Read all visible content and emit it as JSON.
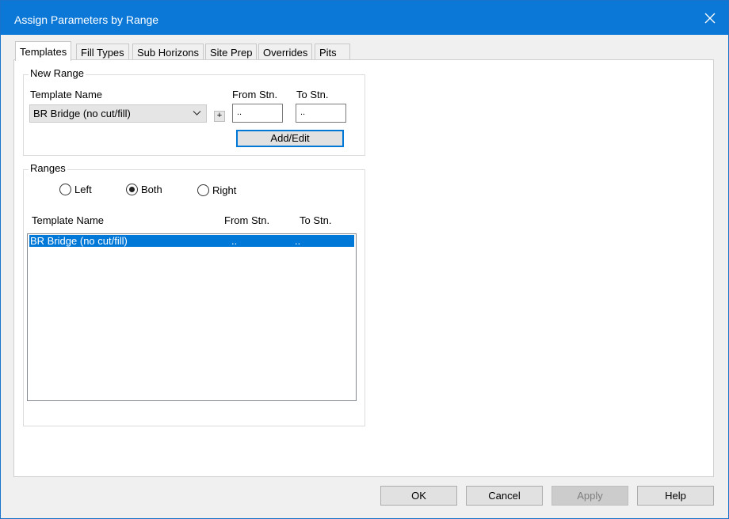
{
  "window": {
    "title": "Assign Parameters by Range",
    "close_icon": "close-icon"
  },
  "tabs": [
    {
      "label": "Templates",
      "active": true
    },
    {
      "label": "Fill Types"
    },
    {
      "label": "Sub Horizons"
    },
    {
      "label": "Site Prep"
    },
    {
      "label": "Overrides"
    },
    {
      "label": "Pits"
    }
  ],
  "new_range": {
    "group_label": "New Range",
    "template_name_label": "Template Name",
    "template_selected": "BR Bridge (no cut/fill)",
    "plus_label": "+",
    "from_stn_label": "From Stn.",
    "to_stn_label": "To Stn.",
    "from_stn_value": "..",
    "to_stn_value": "..",
    "add_edit_label": "Add/Edit"
  },
  "ranges": {
    "group_label": "Ranges",
    "radio_left": "Left",
    "radio_both": "Both",
    "radio_right": "Right",
    "selected_side": "Both",
    "col_template": "Template Name",
    "col_from": "From Stn.",
    "col_to": "To Stn.",
    "rows": [
      {
        "template": "BR Bridge (no cut/fill)",
        "from": "..",
        "to": ".."
      }
    ]
  },
  "buttons": {
    "ok": "OK",
    "cancel": "Cancel",
    "apply": "Apply",
    "help": "Help"
  },
  "colors": {
    "titlebar": "#0b78d7",
    "selection": "#0078d7"
  }
}
